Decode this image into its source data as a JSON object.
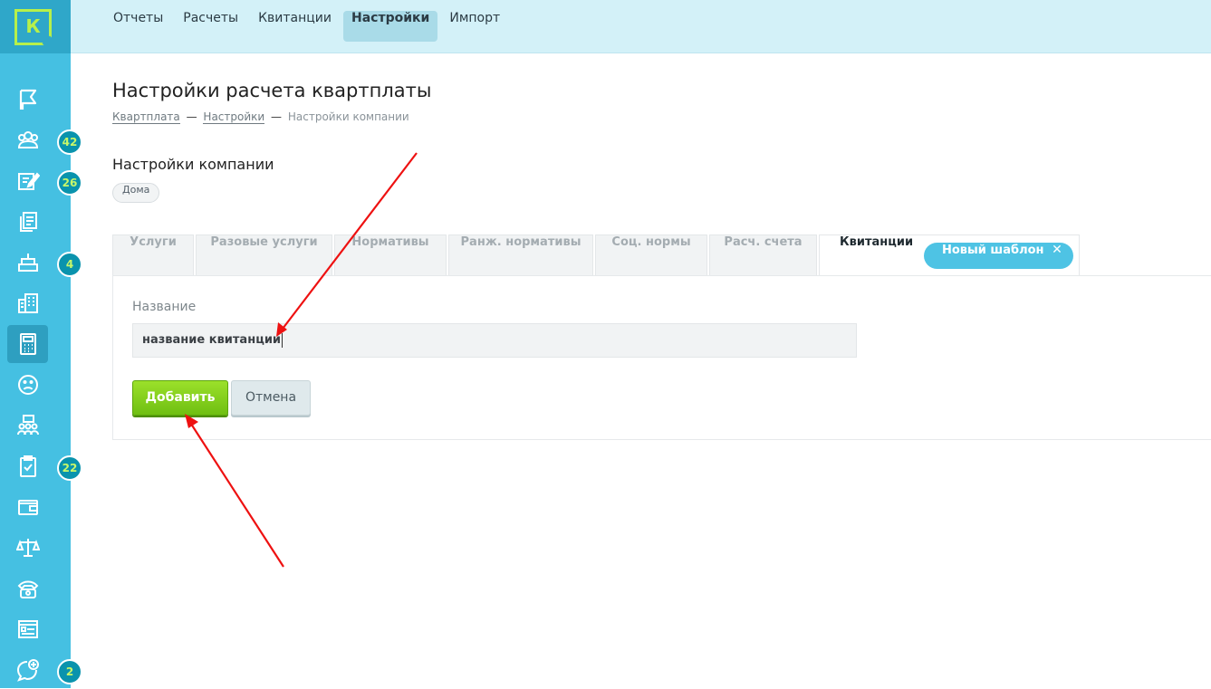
{
  "app": {
    "logo_letter": "К",
    "accent_color": "#45c0e2",
    "brand_green": "#b7f04a"
  },
  "topnav": {
    "items": [
      {
        "label": "Отчеты",
        "active": false
      },
      {
        "label": "Расчеты",
        "active": false
      },
      {
        "label": "Квитанции",
        "active": false
      },
      {
        "label": "Настройки",
        "active": true
      },
      {
        "label": "Импорт",
        "active": false
      }
    ]
  },
  "sidebar": {
    "items": [
      {
        "icon": "flag-icon"
      },
      {
        "icon": "people-group-icon",
        "badge": "42"
      },
      {
        "icon": "edit-note-icon",
        "badge": "26"
      },
      {
        "icon": "documents-icon"
      },
      {
        "icon": "cake-icon",
        "badge": "4"
      },
      {
        "icon": "buildings-icon"
      },
      {
        "icon": "calculator-icon",
        "active": true
      },
      {
        "icon": "sad-face-icon"
      },
      {
        "icon": "team-chat-icon"
      },
      {
        "icon": "clipboard-check-icon",
        "badge": "22"
      },
      {
        "icon": "wallet-icon"
      },
      {
        "icon": "scales-icon"
      },
      {
        "icon": "phone-icon"
      },
      {
        "icon": "form-window-icon"
      },
      {
        "icon": "chat-plus-icon",
        "badge": "2"
      }
    ]
  },
  "page": {
    "title": "Настройки расчета квартплаты",
    "breadcrumb": {
      "item1": "Квартплата",
      "separator": "—",
      "item2": "Настройки",
      "current": "Настройки компании"
    },
    "section_title": "Настройки компании",
    "chip": "Дома"
  },
  "tabs": {
    "items": [
      {
        "label": "Услуги"
      },
      {
        "label": "Разовые услуги"
      },
      {
        "label": "Нормативы"
      },
      {
        "label": "Ранж. нормативы"
      },
      {
        "label": "Соц. нормы"
      },
      {
        "label": "Расч. счета"
      },
      {
        "label": "Квитанции",
        "active": true
      }
    ],
    "new_template_label": "Новый шаблон",
    "new_template_close": "✕"
  },
  "form": {
    "name_label": "Название",
    "name_value": "название квитанции",
    "add_label": "Добавить",
    "cancel_label": "Отмена"
  },
  "annotations": {
    "arrow_color": "#ee1111"
  }
}
